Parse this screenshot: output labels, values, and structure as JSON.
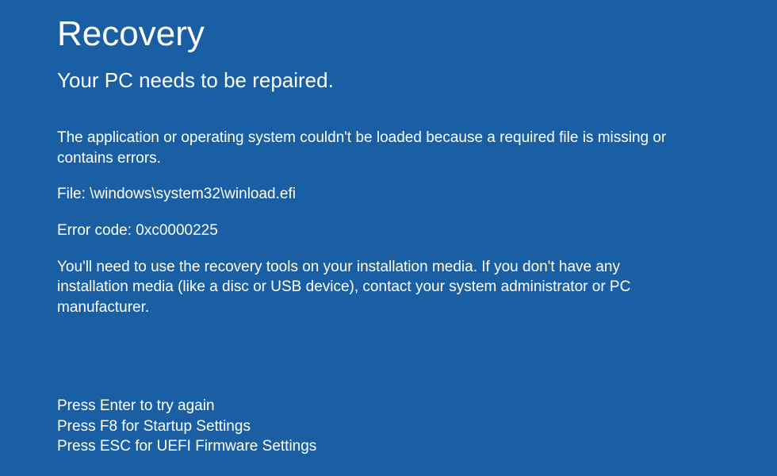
{
  "header": {
    "title": "Recovery",
    "subtitle": "Your PC needs to be repaired."
  },
  "body": {
    "reason": "The application or operating system couldn't be loaded because a required file is missing or contains errors.",
    "file_line": "File: \\windows\\system32\\winload.efi",
    "error_line": "Error code: 0xc0000225",
    "instructions": "You'll need to use the recovery tools on your installation media. If you don't have any installation media (like a disc or USB device), contact your system administrator or PC manufacturer."
  },
  "actions": {
    "enter": "Press Enter to try again",
    "f8": "Press F8 for Startup Settings",
    "esc": "Press ESC for UEFI Firmware Settings"
  }
}
